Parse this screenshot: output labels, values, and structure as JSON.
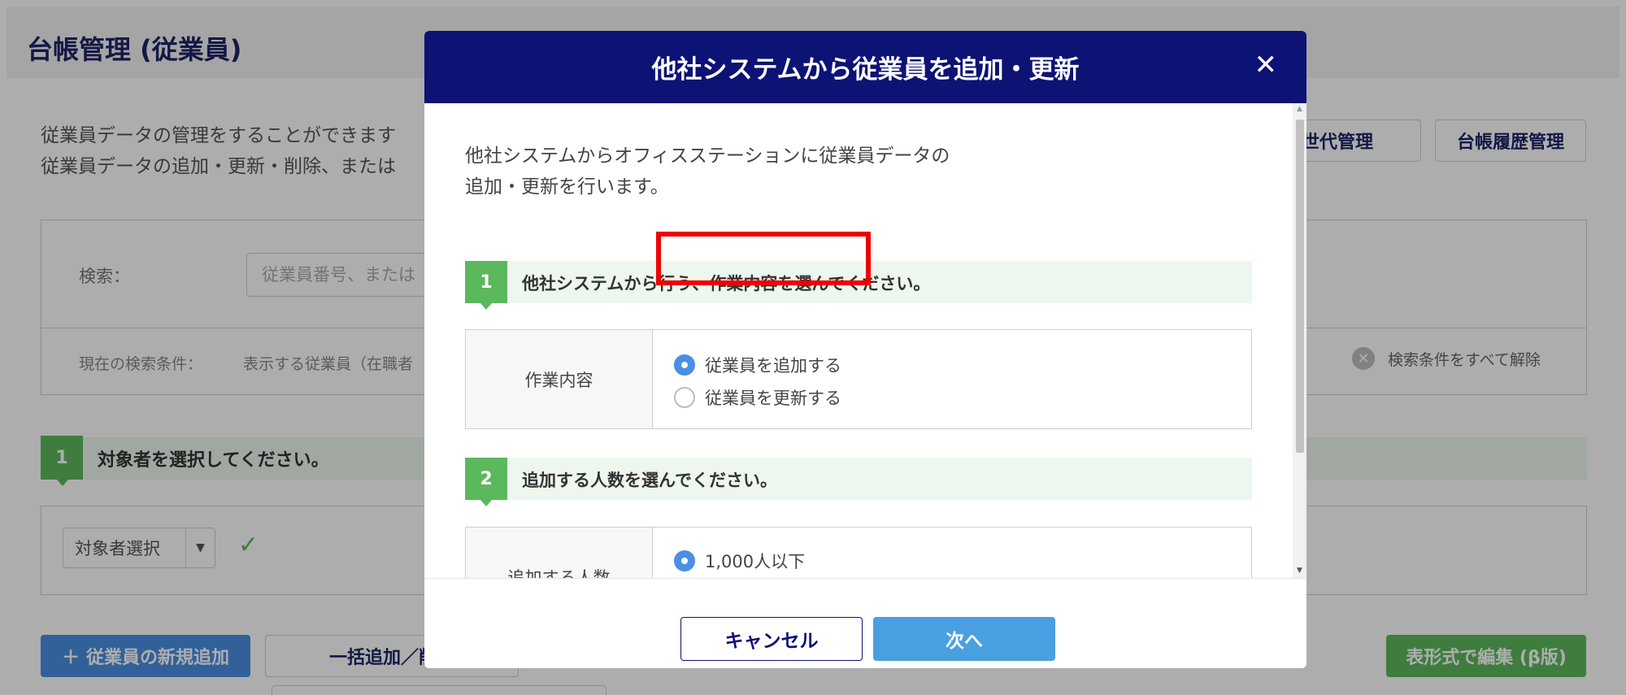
{
  "page": {
    "title": "台帳管理 (従業員)",
    "desc_line1": "従業員データの管理をすることができます",
    "desc_line2": "従業員データの追加・更新・削除、または",
    "gen_button": "の世代管理",
    "history_button": "台帳履歴管理",
    "search_label": "検索：",
    "search_placeholder": "従業員番号、または",
    "cond_label": "現在の検索条件：",
    "cond_value": "表示する従業員（在職者",
    "clear_all": "検索条件をすべて解除",
    "step1_number": "1",
    "step1_text": "対象者を選択してください。",
    "target_select": "対象者選択",
    "add_button": "従業員の新規追加",
    "bulk_button": "一括追加／削除",
    "table_edit_button": "表形式で編集 (β版)"
  },
  "modal": {
    "title": "他社システムから従業員を追加・更新",
    "close_icon": "close-icon",
    "intro_line1": "他社システムからオフィスステーションに従業員データの",
    "intro_line2": "追加・更新を行います。",
    "step1": {
      "number": "1",
      "text": "他社システムから行う、作業内容を選んでください。",
      "label": "作業内容",
      "options": [
        "従業員を追加する",
        "従業員を更新する"
      ],
      "selected": "従業員を追加する"
    },
    "step2": {
      "number": "2",
      "text": "追加する人数を選んでください。",
      "label": "追加する人数",
      "options": [
        "1,000人以下"
      ],
      "selected": "1,000人以下"
    },
    "cancel": "キャンセル",
    "next": "次へ"
  },
  "colors": {
    "modal_header": "#0d1275",
    "step_green": "#5cb85c",
    "step_bg": "#eef7ee",
    "primary_blue": "#4a9fe0",
    "highlight_red": "#ee0000"
  }
}
